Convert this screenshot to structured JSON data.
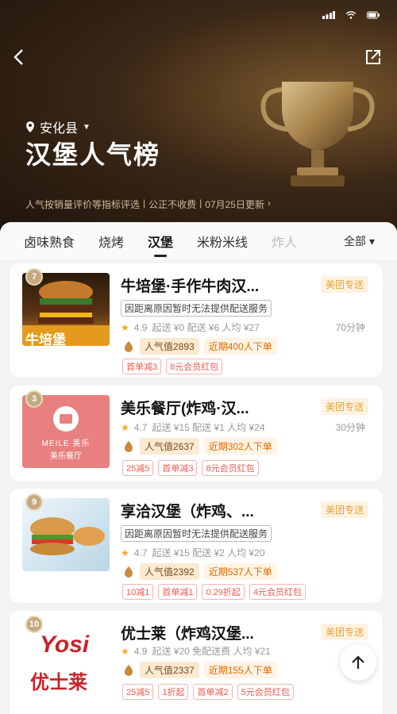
{
  "header": {
    "location": "安化县",
    "title": "汉堡人气榜",
    "note": "人气按销量评价等指标评选",
    "note_sep": "公正不收费",
    "updated": "07月25日更新",
    "updated_arrow": "›"
  },
  "tabs": {
    "items": [
      {
        "label": "卤味熟食"
      },
      {
        "label": "烧烤"
      },
      {
        "label": "汉堡"
      },
      {
        "label": "米粉米线"
      },
      {
        "label": "炸人"
      }
    ],
    "active": "汉堡",
    "all_label": "全部",
    "all_caret": "▾"
  },
  "stores": [
    {
      "rank": "7",
      "name": "牛培堡·手作牛肉汉...",
      "brand": "美团专送",
      "notice": "因距离原因暂时无法提供配送服务",
      "rating": "4.9",
      "meta": "起送 ¥0  配送 ¥6  人均 ¥27",
      "time": "70分钟",
      "popularity": "人气值2893",
      "recent": "近期400人下单",
      "coupons": [
        "首单减3",
        "8元会员红包"
      ],
      "thumb_text": "牛培堡"
    },
    {
      "rank": "3",
      "name": "美乐餐厅(炸鸡·汉...",
      "brand": "美团专送",
      "rating": "4.7",
      "meta": "起送 ¥15  配送 ¥1  人均 ¥24",
      "time": "30分钟",
      "popularity": "人气值2637",
      "recent": "近期302人下单",
      "coupons": [
        "25减5",
        "首单减3",
        "8元会员红包"
      ],
      "thumb_text": "MEILE 美乐",
      "thumb_sub": "美乐餐厅"
    },
    {
      "rank": "9",
      "name": "享洽汉堡（炸鸡、...",
      "brand": "美团专送",
      "notice": "因距离原因暂时无法提供配送服务",
      "rating": "4.7",
      "meta": "起送 ¥15  配送 ¥2  人均 ¥20",
      "popularity": "人气值2392",
      "recent": "近期537人下单",
      "coupons": [
        "10减1",
        "首单减1",
        "0.29折起",
        "4元会员红包"
      ]
    },
    {
      "rank": "10",
      "name": "优士莱（炸鸡汉堡...",
      "brand": "美团专送",
      "rating": "4.9",
      "meta": "起送 ¥20  免配送费  人均 ¥21",
      "popularity": "人气值2337",
      "recent": "近期155人下单",
      "coupons": [
        "25减5",
        "1折起",
        "首单减2",
        "5元会员红包"
      ],
      "thumb_text": "优士莱",
      "thumb_logo": "Yosi"
    }
  ],
  "colors": {
    "accent": "#e9a23b",
    "coupon": "#ee5a4e",
    "hero_dark": "#1e140c"
  }
}
